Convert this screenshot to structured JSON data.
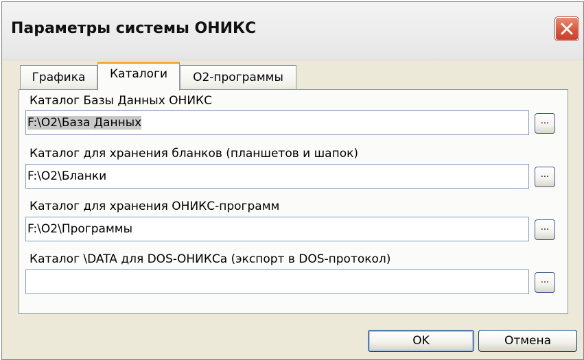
{
  "window": {
    "title": "Параметры системы ОНИКС"
  },
  "tabs": [
    {
      "label": "Графика",
      "active": false
    },
    {
      "label": "Каталоги",
      "active": true
    },
    {
      "label": "О2-программы",
      "active": false
    }
  ],
  "fields": [
    {
      "label": "Каталог Базы Данных ОНИКС",
      "value": "F:\\O2\\База Данных",
      "selected": true
    },
    {
      "label": "Каталог для хранения бланков (планшетов и шапок)",
      "value": "F:\\O2\\Бланки",
      "selected": false
    },
    {
      "label": "Каталог для хранения ОНИКС-программ",
      "value": "F:\\O2\\Программы",
      "selected": false
    },
    {
      "label": "Каталог \\DATA для DOS-ОНИКСа (экспорт в DOS-протокол)",
      "value": "",
      "selected": false
    }
  ],
  "browse_label": "...",
  "buttons": {
    "ok": "OK",
    "cancel": "Отмена"
  },
  "icons": {
    "close": "close-icon"
  },
  "colors": {
    "active_tab_accent": "#f7a835",
    "close_button": "#d9583c",
    "default_button_border": "#003c74"
  }
}
